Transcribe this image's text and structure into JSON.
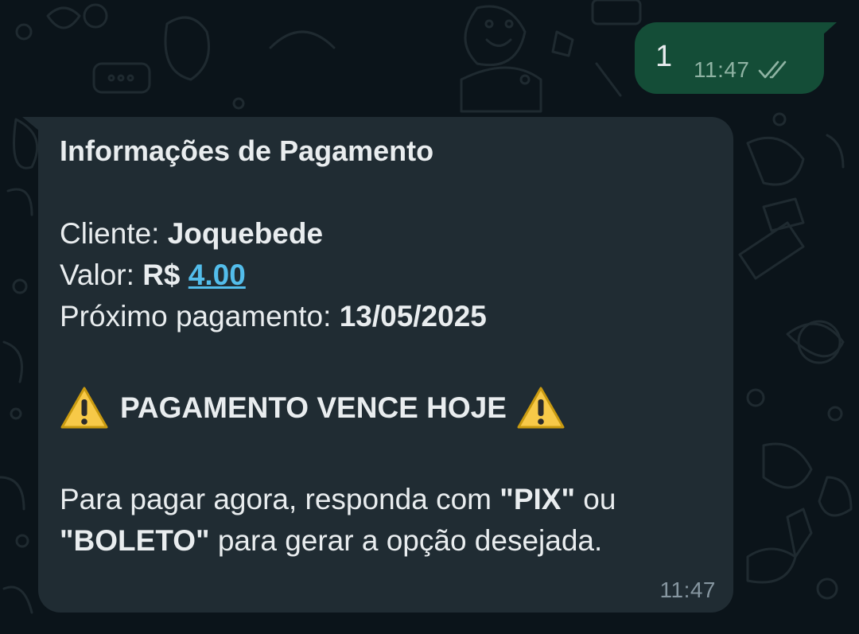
{
  "colors": {
    "background": "#0b141a",
    "outgoing_bubble": "#144d37",
    "incoming_bubble": "#202c33",
    "text": "#e9edef",
    "link": "#53bdeb",
    "timestamp": "#8696a0",
    "read_ticks": "#8fb3a3"
  },
  "outgoing": {
    "text": "1",
    "time": "11:47",
    "status_icon": "double-check-icon"
  },
  "incoming": {
    "title": "Informações de Pagamento",
    "cliente_label": "Cliente: ",
    "cliente_value": "Joquebede",
    "valor_label": "Valor: ",
    "valor_currency": "R$ ",
    "valor_amount": "4.00",
    "proximo_label": "Próximo pagamento: ",
    "proximo_value": "13/05/2025",
    "alert_text": "PAGAMENTO VENCE HOJE",
    "alert_icon": "warning-icon",
    "instructions_part1": "Para pagar agora, responda com ",
    "instructions_pix": "\"PIX\"",
    "instructions_or": " ou",
    "instructions_boleto": "\"BOLETO\"",
    "instructions_part2": " para gerar a opção desejada.",
    "time": "11:47"
  }
}
